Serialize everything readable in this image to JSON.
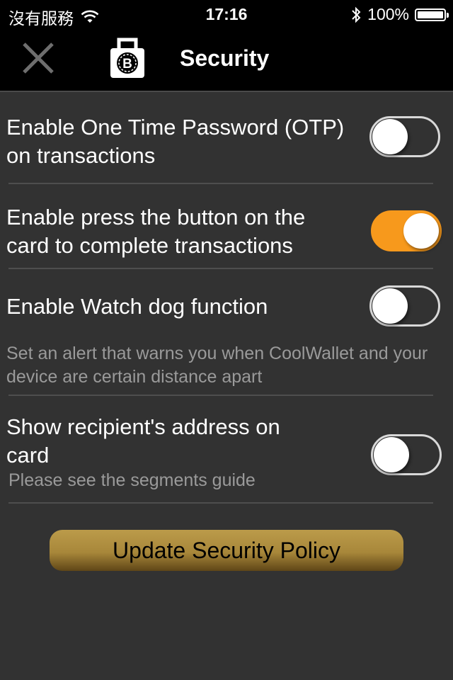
{
  "status_bar": {
    "carrier": "沒有服務",
    "time": "17:16",
    "battery": "100%",
    "battery_level": 1.0,
    "icons": [
      "wifi-icon",
      "bluetooth-icon",
      "battery-icon"
    ]
  },
  "nav": {
    "title": "Security",
    "close_icon": "close-icon",
    "logo_icon": "bitcoin-lock-icon"
  },
  "settings": [
    {
      "title": "Enable One Time Password (OTP) on transactions",
      "enabled": false
    },
    {
      "title": "Enable press the button on the card to complete transactions",
      "enabled": true
    },
    {
      "title": "Enable Watch dog function",
      "subtitle": "Set an alert that warns you when CoolWallet and your device are certain distance apart",
      "enabled": false
    },
    {
      "title": "Show recipient's address on card",
      "subtitle": "Please see the segments guide",
      "enabled": false
    }
  ],
  "update_button": {
    "label": "Update Security Policy"
  },
  "colors": {
    "accent": "#f7991c",
    "background": "#323232",
    "bar": "#000000",
    "button_gold": "#b59442"
  }
}
